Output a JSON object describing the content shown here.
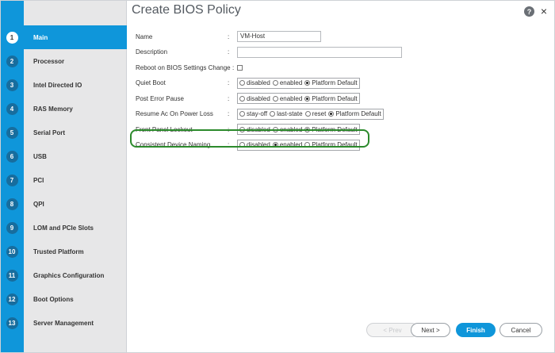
{
  "title": "Create BIOS Policy",
  "help_label": "?",
  "close_label": "×",
  "steps": [
    {
      "num": "1",
      "label": "Main"
    },
    {
      "num": "2",
      "label": "Processor"
    },
    {
      "num": "3",
      "label": "Intel Directed IO"
    },
    {
      "num": "4",
      "label": "RAS Memory"
    },
    {
      "num": "5",
      "label": "Serial Port"
    },
    {
      "num": "6",
      "label": "USB"
    },
    {
      "num": "7",
      "label": "PCI"
    },
    {
      "num": "8",
      "label": "QPI"
    },
    {
      "num": "9",
      "label": "LOM and PCIe Slots"
    },
    {
      "num": "10",
      "label": "Trusted Platform"
    },
    {
      "num": "11",
      "label": "Graphics Configuration"
    },
    {
      "num": "12",
      "label": "Boot Options"
    },
    {
      "num": "13",
      "label": "Server Management"
    }
  ],
  "form": {
    "colon": ":",
    "name_label": "Name",
    "name_value": "VM-Host",
    "description_label": "Description",
    "description_value": "",
    "reboot_label": "Reboot on BIOS Settings Change",
    "quiet_boot_label": "Quiet Boot",
    "post_error_label": "Post Error Pause",
    "resume_label": "Resume Ac On Power Loss",
    "front_panel_label": "Front Panel Lockout",
    "cdn_label": "Consistent Device Naming",
    "opt_disabled": "disabled",
    "opt_enabled": "enabled",
    "opt_platform_default": "Platform Default",
    "opt_stay_off": "stay-off",
    "opt_last_state": "last-state",
    "opt_reset": "reset"
  },
  "buttons": {
    "prev": "< Prev",
    "next": "Next >",
    "finish": "Finish",
    "cancel": "Cancel"
  }
}
